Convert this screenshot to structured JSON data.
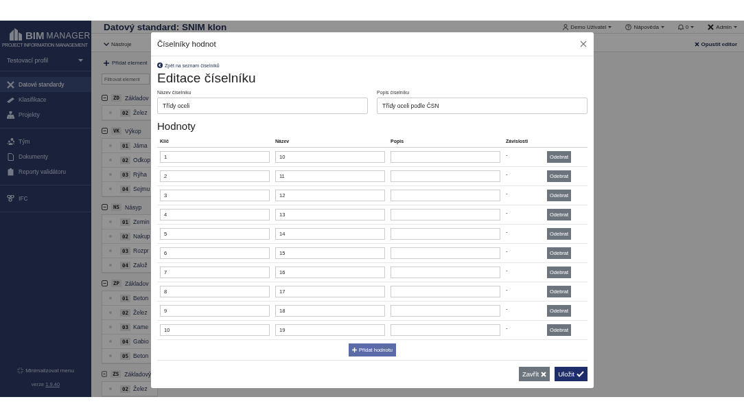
{
  "sidebar": {
    "logo": {
      "brand": "BIM",
      "product": "MANAGER",
      "tagline": "PROJECT INFORMATION MANAGEMENT"
    },
    "profile": "Testovací profil",
    "groups": [
      [
        {
          "label": "Datové standardy",
          "selected": true
        },
        {
          "label": "Klasifikace",
          "selected": false
        },
        {
          "label": "Projekty",
          "selected": false
        }
      ],
      [
        {
          "label": "Tým",
          "selected": false
        },
        {
          "label": "Dokumenty",
          "selected": false
        },
        {
          "label": "Reporty validátoru",
          "selected": false
        }
      ],
      [
        {
          "label": "IFC",
          "selected": false
        }
      ]
    ],
    "minimize": "Minimalizovat menu",
    "version_label": "verze",
    "version": "1.9.40"
  },
  "header": {
    "title": "Datový standard: SNIM klon",
    "user": "Demo Uživatel",
    "help": "Nápověda",
    "notifications": "0",
    "admin": "Admin"
  },
  "toolbar": {
    "tools": "Nástroje",
    "exit": "Opustit editor"
  },
  "editor": {
    "add_element": "Přidat element",
    "filter": {
      "placeholder": "Filtrovat element"
    },
    "tree": [
      {
        "code": "ZD",
        "name": "Základov",
        "expanded": true,
        "children": [
          {
            "code": "02",
            "name": "Želez"
          }
        ]
      },
      {
        "code": "VK",
        "name": "Výkop",
        "expanded": true,
        "children": [
          {
            "code": "01",
            "name": "Jáma"
          },
          {
            "code": "02",
            "name": "Odkop"
          },
          {
            "code": "03",
            "name": "Rýha"
          },
          {
            "code": "04",
            "name": "Sejmu"
          }
        ]
      },
      {
        "code": "NS",
        "name": "Násyp",
        "expanded": true,
        "children": [
          {
            "code": "01",
            "name": "Zemin"
          },
          {
            "code": "02",
            "name": "Nakup"
          },
          {
            "code": "03",
            "name": "Rozpr"
          },
          {
            "code": "04",
            "name": "Založ"
          }
        ]
      },
      {
        "code": "ZP",
        "name": "Základov",
        "expanded": true,
        "children": [
          {
            "code": "01",
            "name": "Beton"
          },
          {
            "code": "02",
            "name": "Želez"
          },
          {
            "code": "03",
            "name": "Kame"
          },
          {
            "code": "04",
            "name": "Gabio"
          },
          {
            "code": "05",
            "name": "Beton"
          }
        ]
      },
      {
        "code": "ZS",
        "name": "Základový",
        "expanded": true,
        "children": [
          {
            "code": "02",
            "name": "Želez"
          }
        ]
      }
    ]
  },
  "modal": {
    "title": "Číselníky hodnot",
    "back_link": "Zpět na seznam číselníků",
    "heading": "Editace číselníku",
    "name_field": {
      "label": "Název číselníku",
      "value": "Třídy oceli"
    },
    "description_field": {
      "label": "Popis číselníku",
      "value": "Třídy oceli podle ČSN"
    },
    "values_heading": "Hodnoty",
    "columns": [
      "Klíč",
      "Název",
      "Popis",
      "Závislosti"
    ],
    "rows": [
      {
        "key": "1",
        "name": "10",
        "dependencies": "-",
        "action": "Odebrat"
      },
      {
        "key": "2",
        "name": "11",
        "dependencies": "-",
        "action": "Odebrat"
      },
      {
        "key": "3",
        "name": "12",
        "dependencies": "-",
        "action": "Odebrat"
      },
      {
        "key": "4",
        "name": "13",
        "dependencies": "-",
        "action": "Odebrat"
      },
      {
        "key": "5",
        "name": "14",
        "dependencies": "-",
        "action": "Odebrat"
      },
      {
        "key": "6",
        "name": "15",
        "dependencies": "-",
        "action": "Odebrat"
      },
      {
        "key": "7",
        "name": "16",
        "dependencies": "-",
        "action": "Odebrat"
      },
      {
        "key": "8",
        "name": "17",
        "dependencies": "-",
        "action": "Odebrat"
      },
      {
        "key": "9",
        "name": "18",
        "dependencies": "-",
        "action": "Odebrat"
      },
      {
        "key": "10",
        "name": "19",
        "dependencies": "-",
        "action": "Odebrat"
      }
    ],
    "add_value": "Přidat hodnotu",
    "close": "Zavřít",
    "save": "Uložit"
  }
}
